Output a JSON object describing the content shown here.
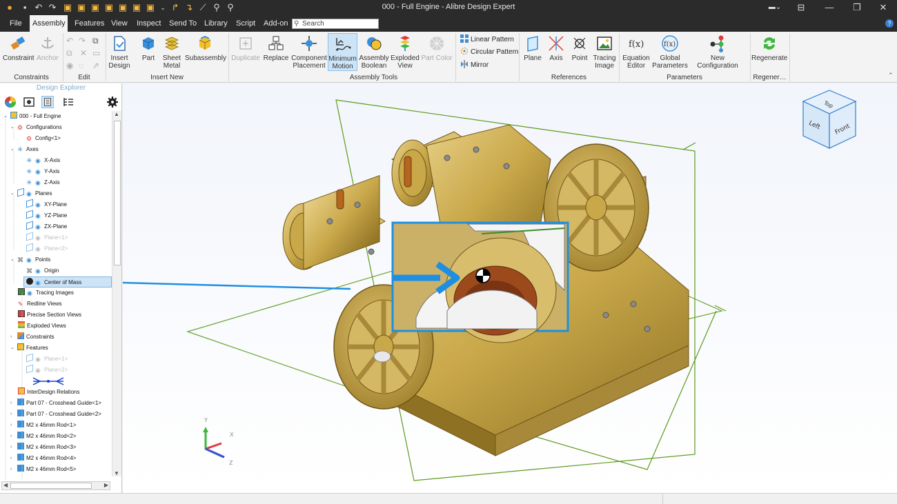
{
  "window": {
    "title": "000 - Full Engine - Alibre Design Expert",
    "controls": [
      "minimize-icon",
      "restore-icon",
      "close-icon"
    ]
  },
  "menu": {
    "items": [
      "File",
      "Assembly",
      "Features",
      "View",
      "Inspect",
      "Send To",
      "Library",
      "Script",
      "Add-on"
    ],
    "active": "Assembly",
    "search_placeholder": "Search"
  },
  "ribbon": {
    "groups": {
      "constraints": "Constraints",
      "edit": "Edit",
      "insert_new": "Insert New",
      "assembly_tools": "Assembly Tools",
      "references": "References",
      "parameters": "Parameters",
      "regenerate": "Regener…"
    },
    "buttons": {
      "constraint": "Constraint",
      "anchor": "Anchor",
      "insert_design_1": "Insert",
      "insert_design_2": "Design",
      "part": "Part",
      "sheet_metal_1": "Sheet",
      "sheet_metal_2": "Metal",
      "subassembly": "Subassembly",
      "duplicate": "Duplicate",
      "replace": "Replace",
      "component_placement_1": "Component",
      "component_placement_2": "Placement",
      "minimum_motion_1": "Minimum",
      "minimum_motion_2": "Motion",
      "assembly_boolean_1": "Assembly",
      "assembly_boolean_2": "Boolean",
      "exploded_view_1": "Exploded",
      "exploded_view_2": "View",
      "part_color": "Part Color",
      "linear_pattern": "Linear Pattern",
      "circular_pattern": "Circular Pattern",
      "mirror": "Mirror",
      "plane": "Plane",
      "axis": "Axis",
      "point": "Point",
      "tracing_image_1": "Tracing",
      "tracing_image_2": "Image",
      "equation_editor_1": "Equation",
      "equation_editor_2": "Editor",
      "global_parameters_1": "Global",
      "global_parameters_2": "Parameters",
      "new_configuration": "New Configuration",
      "regenerate": "Regenerate"
    }
  },
  "explorer": {
    "title": "Design Explorer",
    "tree": [
      {
        "label": "000 - Full Engine",
        "icon": "assembly-icon",
        "dim": false,
        "selected": false
      },
      {
        "label": "Configurations",
        "icon": "configurations-icon",
        "dim": false,
        "selected": false
      },
      {
        "label": "Config<1>",
        "icon": "config-icon",
        "dim": false,
        "selected": false
      },
      {
        "label": "Axes",
        "icon": "axes-icon",
        "dim": false,
        "selected": false
      },
      {
        "label": "X-Axis",
        "icon": "axis-icon",
        "dim": false,
        "selected": false
      },
      {
        "label": "Y-Axis",
        "icon": "axis-icon",
        "dim": false,
        "selected": false
      },
      {
        "label": "Z-Axis",
        "icon": "axis-icon",
        "dim": false,
        "selected": false
      },
      {
        "label": "Planes",
        "icon": "planes-icon",
        "dim": false,
        "selected": false
      },
      {
        "label": "XY-Plane",
        "icon": "plane-icon",
        "dim": false,
        "selected": false
      },
      {
        "label": "YZ-Plane",
        "icon": "plane-icon",
        "dim": false,
        "selected": false
      },
      {
        "label": "ZX-Plane",
        "icon": "plane-icon",
        "dim": false,
        "selected": false
      },
      {
        "label": "Plane<1>",
        "icon": "plane-icon",
        "dim": true,
        "selected": false
      },
      {
        "label": "Plane<2>",
        "icon": "plane-icon",
        "dim": true,
        "selected": false
      },
      {
        "label": "Points",
        "icon": "points-icon",
        "dim": false,
        "selected": false
      },
      {
        "label": "Origin",
        "icon": "origin-icon",
        "dim": false,
        "selected": false
      },
      {
        "label": "Center of Mass",
        "icon": "center-of-mass-icon",
        "dim": false,
        "selected": true
      },
      {
        "label": "Tracing Images",
        "icon": "tracing-image-icon",
        "dim": false,
        "selected": false
      },
      {
        "label": "Redline Views",
        "icon": "redline-icon",
        "dim": false,
        "selected": false
      },
      {
        "label": "Precise Section Views",
        "icon": "section-view-icon",
        "dim": false,
        "selected": false
      },
      {
        "label": "Exploded Views",
        "icon": "exploded-view-icon",
        "dim": false,
        "selected": false
      },
      {
        "label": "Constraints",
        "icon": "constraints-icon",
        "dim": false,
        "selected": false
      },
      {
        "label": "Features",
        "icon": "features-icon",
        "dim": false,
        "selected": false
      },
      {
        "label": "Plane<1>",
        "icon": "plane-icon",
        "dim": true,
        "selected": false
      },
      {
        "label": "Plane<2>",
        "icon": "plane-icon",
        "dim": true,
        "selected": false
      },
      {
        "label": "",
        "icon": "feature-marker-icon",
        "dim": false,
        "selected": false
      },
      {
        "label": "InterDesign Relations",
        "icon": "interdesign-icon",
        "dim": false,
        "selected": false
      },
      {
        "label": "Part 07 - Crosshead Guide<1>",
        "icon": "part-icon",
        "dim": false,
        "selected": false
      },
      {
        "label": "Part 07 - Crosshead Guide<2>",
        "icon": "part-icon",
        "dim": false,
        "selected": false
      },
      {
        "label": "M2 x 46mm Rod<1>",
        "icon": "part-icon",
        "dim": false,
        "selected": false
      },
      {
        "label": "M2 x 46mm Rod<2>",
        "icon": "part-icon",
        "dim": false,
        "selected": false
      },
      {
        "label": "M2 x 46mm Rod<3>",
        "icon": "part-icon",
        "dim": false,
        "selected": false
      },
      {
        "label": "M2 x 46mm Rod<4>",
        "icon": "part-icon",
        "dim": false,
        "selected": false
      },
      {
        "label": "M2 x 46mm Rod<5>",
        "icon": "part-icon",
        "dim": false,
        "selected": false
      }
    ]
  },
  "viewcube": {
    "top": "Top",
    "left": "Left",
    "front": "Front"
  },
  "triad": {
    "y": "Y",
    "x": "X",
    "z": "Z"
  },
  "colors": {
    "accent": "#1e8fe0",
    "brass": "#c9a84a",
    "plane_green": "#5a9a1a",
    "dark_bar": "#2b2b2b"
  }
}
